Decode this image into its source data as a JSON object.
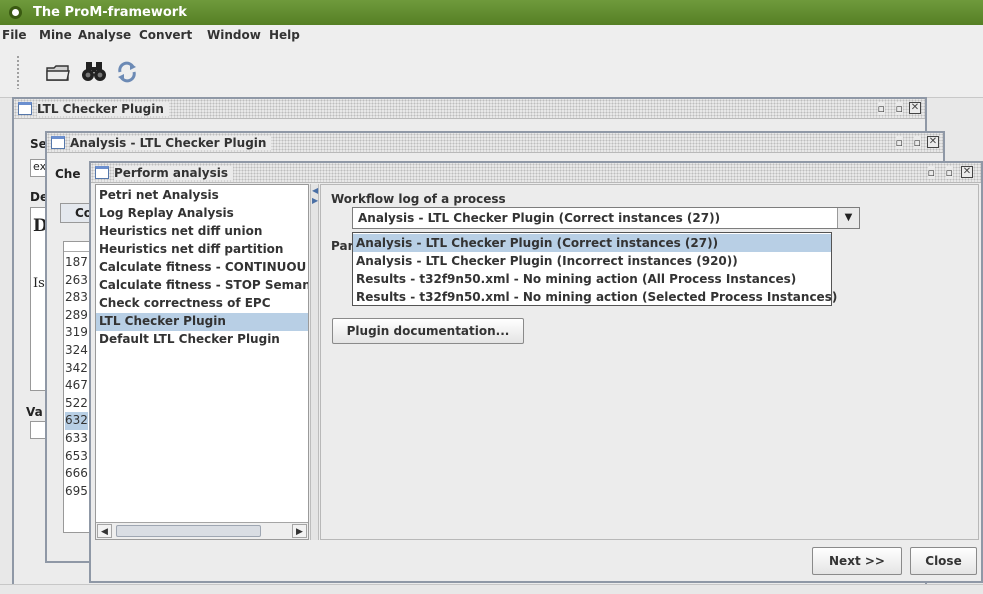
{
  "app": {
    "title": "The ProM-framework"
  },
  "menu": [
    "File",
    "Mine",
    "Analyse",
    "Convert",
    "Window",
    "Help"
  ],
  "toolbar": {
    "icons": [
      "folder-open-icon",
      "binoculars-icon",
      "refresh-icon"
    ]
  },
  "window_ltl": {
    "title": "LTL Checker Plugin",
    "partial_labels": [
      "Se",
      "ex",
      "De",
      "D",
      "Is",
      "Va"
    ]
  },
  "window_analysis": {
    "title": "Analysis - LTL Checker Plugin",
    "partial_labels": [
      "Che",
      "Co"
    ],
    "instance_ids": [
      "187",
      "263",
      "283",
      "289",
      "319",
      "324",
      "342",
      "467",
      "522",
      "632",
      "633",
      "653",
      "666",
      "695"
    ]
  },
  "window_perform": {
    "title": "Perform analysis",
    "plugins": [
      "Petri net Analysis",
      "Log Replay Analysis",
      "Heuristics net diff union",
      "Heuristics net diff partition",
      "Calculate fitness - CONTINUOU",
      "Calculate fitness - STOP Seman",
      "Check correctness of EPC",
      "LTL Checker Plugin",
      "Default LTL Checker Plugin"
    ],
    "selected_plugin_index": 7,
    "log_label": "Workflow log of a process",
    "param_label_partial": "Par",
    "combo_value": "Analysis - LTL Checker Plugin (Correct instances (27))",
    "dropdown_options": [
      "Analysis - LTL Checker Plugin (Correct instances (27))",
      "Analysis - LTL Checker Plugin (Incorrect instances (920))",
      "Results - t32f9n50.xml - No mining action (All Process Instances)",
      "Results - t32f9n50.xml - No mining action (Selected Process Instances)"
    ],
    "selected_option_index": 0,
    "doc_button": "Plugin documentation...",
    "next_button": "Next >>",
    "close_button": "Close"
  },
  "colors": {
    "titlebar": "#5f8a2c",
    "selection": "#b8cfe5",
    "frame_border": "#8f98a6"
  }
}
